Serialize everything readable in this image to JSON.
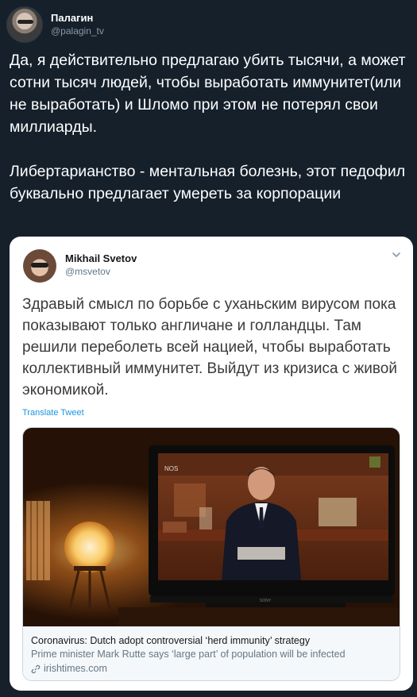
{
  "tweet": {
    "author": {
      "display_name": "Палагин",
      "handle": "@palagin_tv"
    },
    "text": "Да, я действительно предлагаю убить тысячи, а может сотни тысяч людей, чтобы выработать иммунитет(или не выработать) и Шломо при этом не потерял свои миллиарды.\n\nЛибертарианство - ментальная болезнь, этот педофил буквально предлагает умереть за корпорации"
  },
  "quoted_tweet": {
    "author": {
      "display_name": "Mikhail Svetov",
      "handle": "@msvetov"
    },
    "text": "Здравый смысл по борьбе с уханьским вирусом пока показывают только англичане и голландцы. Там решили переболеть всей нацией, чтобы выработать коллективный иммунитет. Выйдут из кризиса с живой экономикой.",
    "translate_label": "Translate Tweet",
    "link_card": {
      "title": "Coronavirus: Dutch adopt controversial ‘herd immunity’ strategy",
      "description": "Prime minister Mark Rutte says ‘large part’ of population will be infected",
      "domain": "irishtimes.com",
      "domain_icon": "link-icon",
      "image_subject": "tv-broadcast-photo",
      "tv_logo_text": "NOS",
      "tv_brand_text": "SONY"
    }
  },
  "colors": {
    "background": "#15202b",
    "card_background": "#ffffff",
    "link_blue": "#1b95e0",
    "secondary_text": "#657786"
  }
}
